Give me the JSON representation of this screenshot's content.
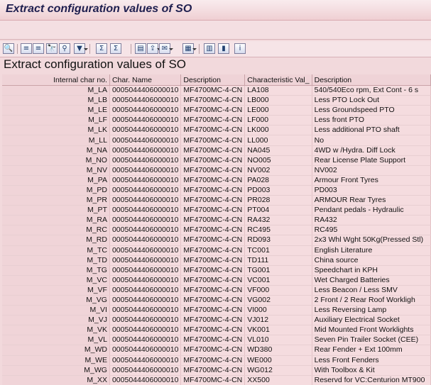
{
  "window": {
    "title": "Extract configuration values of SO"
  },
  "report": {
    "title": "Extract configuration values of SO"
  },
  "toolbar": {
    "buttons": [
      {
        "name": "details-icon",
        "glyph": "🔍"
      },
      {
        "name": "sort-asc-icon",
        "glyph": "≡"
      },
      {
        "name": "sort-desc-icon",
        "glyph": "≡"
      },
      {
        "name": "find-icon",
        "glyph": "🔭"
      },
      {
        "name": "find-next-icon",
        "glyph": "⚲"
      },
      {
        "name": "filter-icon",
        "glyph": "▼"
      },
      {
        "name": "total-icon",
        "glyph": "Σ"
      },
      {
        "name": "subtotal-icon",
        "glyph": "Σ"
      },
      {
        "name": "print-preview-icon",
        "glyph": "▤"
      },
      {
        "name": "export-icon",
        "glyph": "⇪"
      },
      {
        "name": "send-icon",
        "glyph": "✉"
      },
      {
        "name": "layout-icon",
        "glyph": "▦"
      },
      {
        "name": "abc-analysis-icon",
        "glyph": "▥"
      },
      {
        "name": "graphic-icon",
        "glyph": "▮"
      },
      {
        "name": "info-icon",
        "glyph": "i"
      }
    ]
  },
  "table": {
    "columns": [
      "Internal char no.",
      "Char. Name",
      "Description",
      "Characteristic Val_",
      "Description"
    ],
    "rows": [
      [
        "M_LA",
        "0005044406000010",
        "MF4700MC-4-CN",
        "LA108",
        "540/540Eco rpm, Ext Cont - 6 s"
      ],
      [
        "M_LB",
        "0005044406000010",
        "MF4700MC-4-CN",
        "LB000",
        "Less PTO Lock Out"
      ],
      [
        "M_LE",
        "0005044406000010",
        "MF4700MC-4-CN",
        "LE000",
        "Less Groundspeed PTO"
      ],
      [
        "M_LF",
        "0005044406000010",
        "MF4700MC-4-CN",
        "LF000",
        "Less front PTO"
      ],
      [
        "M_LK",
        "0005044406000010",
        "MF4700MC-4-CN",
        "LK000",
        "Less additional PTO shaft"
      ],
      [
        "M_LL",
        "0005044406000010",
        "MF4700MC-4-CN",
        "LL000",
        "No"
      ],
      [
        "M_NA",
        "0005044406000010",
        "MF4700MC-4-CN",
        "NA045",
        "4WD w /Hydra. Diff Lock"
      ],
      [
        "M_NO",
        "0005044406000010",
        "MF4700MC-4-CN",
        "NO005",
        "Rear License Plate Support"
      ],
      [
        "M_NV",
        "0005044406000010",
        "MF4700MC-4-CN",
        "NV002",
        "NV002"
      ],
      [
        "M_PA",
        "0005044406000010",
        "MF4700MC-4-CN",
        "PA028",
        "Armour Front Tyres"
      ],
      [
        "M_PD",
        "0005044406000010",
        "MF4700MC-4-CN",
        "PD003",
        "PD003"
      ],
      [
        "M_PR",
        "0005044406000010",
        "MF4700MC-4-CN",
        "PR028",
        "ARMOUR Rear Tyres"
      ],
      [
        "M_PT",
        "0005044406000010",
        "MF4700MC-4-CN",
        "PT004",
        "Pendant pedals - Hydraulic"
      ],
      [
        "M_RA",
        "0005044406000010",
        "MF4700MC-4-CN",
        "RA432",
        "RA432"
      ],
      [
        "M_RC",
        "0005044406000010",
        "MF4700MC-4-CN",
        "RC495",
        "RC495"
      ],
      [
        "M_RD",
        "0005044406000010",
        "MF4700MC-4-CN",
        "RD093",
        "2x3 Whl Wght 50Kg(Pressed Stl)"
      ],
      [
        "M_TC",
        "0005044406000010",
        "MF4700MC-4-CN",
        "TC001",
        "English Literature"
      ],
      [
        "M_TD",
        "0005044406000010",
        "MF4700MC-4-CN",
        "TD111",
        "China source"
      ],
      [
        "M_TG",
        "0005044406000010",
        "MF4700MC-4-CN",
        "TG001",
        "Speedchart in KPH"
      ],
      [
        "M_VC",
        "0005044406000010",
        "MF4700MC-4-CN",
        "VC001",
        "Wet Charged Batteries"
      ],
      [
        "M_VF",
        "0005044406000010",
        "MF4700MC-4-CN",
        "VF000",
        "Less Beacon / Less SMV"
      ],
      [
        "M_VG",
        "0005044406000010",
        "MF4700MC-4-CN",
        "VG002",
        "2 Front / 2 Rear Roof Workligh"
      ],
      [
        "M_VI",
        "0005044406000010",
        "MF4700MC-4-CN",
        "VI000",
        "Less Reversing Lamp"
      ],
      [
        "M_VJ",
        "0005044406000010",
        "MF4700MC-4-CN",
        "VJ012",
        "Auxiliary Electrical Socket"
      ],
      [
        "M_VK",
        "0005044406000010",
        "MF4700MC-4-CN",
        "VK001",
        "Mid Mounted Front Worklights"
      ],
      [
        "M_VL",
        "0005044406000010",
        "MF4700MC-4-CN",
        "VL010",
        "Seven Pin Trailer Socket (CEE)"
      ],
      [
        "M_WD",
        "0005044406000010",
        "MF4700MC-4-CN",
        "WD380",
        "Rear Fender + Ext 100mm"
      ],
      [
        "M_WE",
        "0005044406000010",
        "MF4700MC-4-CN",
        "WE000",
        "Less Front Fenders"
      ],
      [
        "M_WG",
        "0005044406000010",
        "MF4700MC-4-CN",
        "WG012",
        "With Toolbox & Kit"
      ],
      [
        "M_XX",
        "0005044406000010",
        "MF4700MC-4-CN",
        "XX500",
        "Reservd for VC:Centurion MT900"
      ]
    ]
  }
}
